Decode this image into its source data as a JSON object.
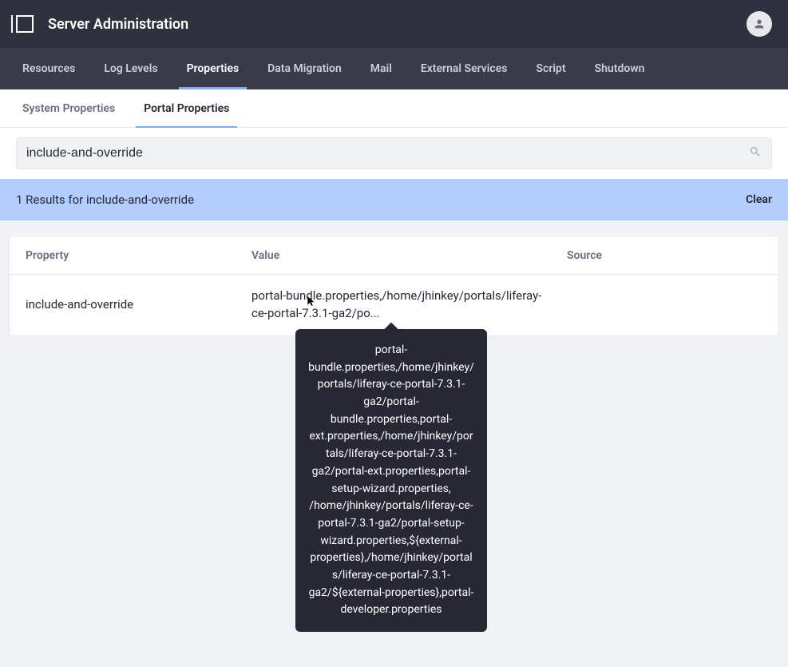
{
  "header": {
    "title": "Server Administration"
  },
  "mainTabs": [
    {
      "label": "Resources",
      "active": false
    },
    {
      "label": "Log Levels",
      "active": false
    },
    {
      "label": "Properties",
      "active": true
    },
    {
      "label": "Data Migration",
      "active": false
    },
    {
      "label": "Mail",
      "active": false
    },
    {
      "label": "External Services",
      "active": false
    },
    {
      "label": "Script",
      "active": false
    },
    {
      "label": "Shutdown",
      "active": false
    }
  ],
  "subTabs": [
    {
      "label": "System Properties",
      "active": false
    },
    {
      "label": "Portal Properties",
      "active": true
    }
  ],
  "search": {
    "value": "include-and-override",
    "placeholder": "Search"
  },
  "resultsBar": {
    "text": "1 Results for include-and-override",
    "clearLabel": "Clear"
  },
  "table": {
    "headers": {
      "property": "Property",
      "value": "Value",
      "source": "Source"
    },
    "rows": [
      {
        "property": "include-and-override",
        "value": "portal-bundle.properties,/home/jhinkey/portals/liferay-ce-portal-7.3.1-ga2/po...",
        "source": ""
      }
    ]
  },
  "tooltip": {
    "text": "portal-bundle.properties,/home/jhinkey/portals/liferay-ce-portal-7.3.1-ga2/portal-bundle.properties,portal-ext.properties,/home/jhinkey/portals/liferay-ce-portal-7.3.1-ga2/portal-ext.properties,portal-setup-wizard.properties, /home/jhinkey/portals/liferay-ce-portal-7.3.1-ga2/portal-setup-wizard.properties,${external-properties},/home/jhinkey/portals/liferay-ce-portal-7.3.1-ga2/${external-properties},portal-developer.properties"
  }
}
